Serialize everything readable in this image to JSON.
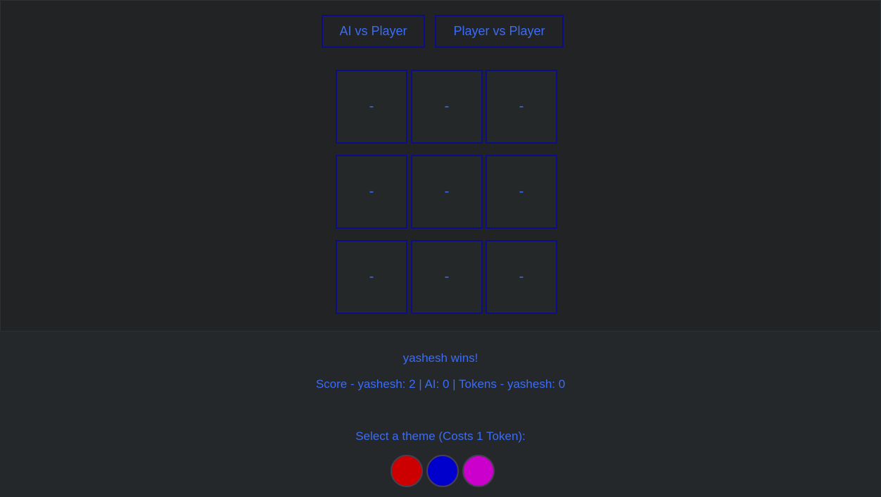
{
  "modes": {
    "ai_vs_player": "AI vs Player",
    "player_vs_player": "Player vs Player"
  },
  "board": {
    "cells": [
      "-",
      "-",
      "-",
      "-",
      "-",
      "-",
      "-",
      "-",
      "-"
    ]
  },
  "status": {
    "winner_text": "yashesh wins!",
    "score_text": "Score - yashesh: 2 | AI: 0 | Tokens - yashesh: 0"
  },
  "theme": {
    "label": "Select a theme (Costs 1 Token):",
    "options": [
      {
        "name": "red",
        "color": "#cc0000"
      },
      {
        "name": "blue",
        "color": "#0000cc"
      },
      {
        "name": "magenta",
        "color": "#cc00cc"
      }
    ]
  },
  "colors": {
    "accent": "#3b6cf5",
    "border": "#0d0d8a",
    "background": "#23272a"
  }
}
